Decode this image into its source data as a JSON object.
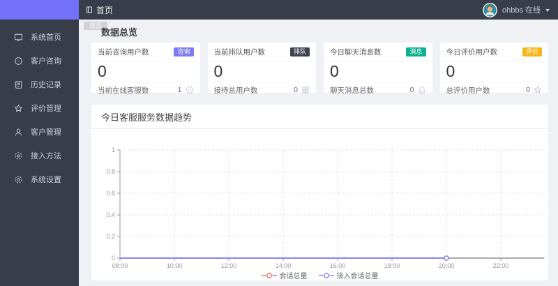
{
  "sidebar": {
    "items": [
      {
        "label": "系统首页"
      },
      {
        "label": "客户咨询"
      },
      {
        "label": "历史记录"
      },
      {
        "label": "评价管理"
      },
      {
        "label": "客户管理"
      },
      {
        "label": "接入方法"
      },
      {
        "label": "系统设置"
      }
    ]
  },
  "header": {
    "title": "首页",
    "username": "ohbbs 在线"
  },
  "tabs": {
    "active": "首页"
  },
  "overview": {
    "section_title": "数据总览",
    "cards": [
      {
        "title": "当前咨询用户数",
        "badge": "咨询",
        "badge_color": "#7d7af2",
        "value": "0",
        "footer_label": "当前在线客服数",
        "footer_value": "1"
      },
      {
        "title": "当前排队用户数",
        "badge": "排队",
        "badge_color": "#3e4250",
        "value": "0",
        "footer_label": "接待总用户数",
        "footer_value": "0"
      },
      {
        "title": "今日聊天消息数",
        "badge": "消息",
        "badge_color": "#0cb18f",
        "value": "0",
        "footer_label": "聊天消息总数",
        "footer_value": "0"
      },
      {
        "title": "今日评价用户数",
        "badge": "评价",
        "badge_color": "#f7b617",
        "value": "0",
        "footer_label": "总评价用户数",
        "footer_value": "0"
      }
    ]
  },
  "trend": {
    "title": "今日客服服务数据趋势"
  },
  "chart_data": {
    "type": "line",
    "title": "今日客服服务数据趋势",
    "x_ticks": [
      "08:00",
      "10:00",
      "12:00",
      "14:00",
      "16:00",
      "18:00",
      "20:00",
      "22:00"
    ],
    "x_range_hours": [
      8,
      23.6
    ],
    "y_ticks": [
      0,
      0.2,
      0.4,
      0.6,
      0.8,
      1
    ],
    "ylim": [
      0,
      1
    ],
    "grid": "dashed",
    "legend_position": "bottom-center",
    "series": [
      {
        "name": "会话总量",
        "color": "#f56c6c",
        "x": [
          "08:00",
          "09:00",
          "10:00",
          "11:00",
          "12:00",
          "13:00",
          "14:00",
          "15:00",
          "16:00",
          "17:00",
          "18:00",
          "19:00",
          "20:00"
        ],
        "values": [
          0,
          0,
          0,
          0,
          0,
          0,
          0,
          0,
          0,
          0,
          0,
          0,
          0
        ]
      },
      {
        "name": "接入会话总量",
        "color": "#8486f8",
        "x": [
          "08:00",
          "09:00",
          "10:00",
          "11:00",
          "12:00",
          "13:00",
          "14:00",
          "15:00",
          "16:00",
          "17:00",
          "18:00",
          "19:00",
          "20:00"
        ],
        "values": [
          0,
          0,
          0,
          0,
          0,
          0,
          0,
          0,
          0,
          0,
          0,
          0,
          0
        ]
      }
    ]
  }
}
